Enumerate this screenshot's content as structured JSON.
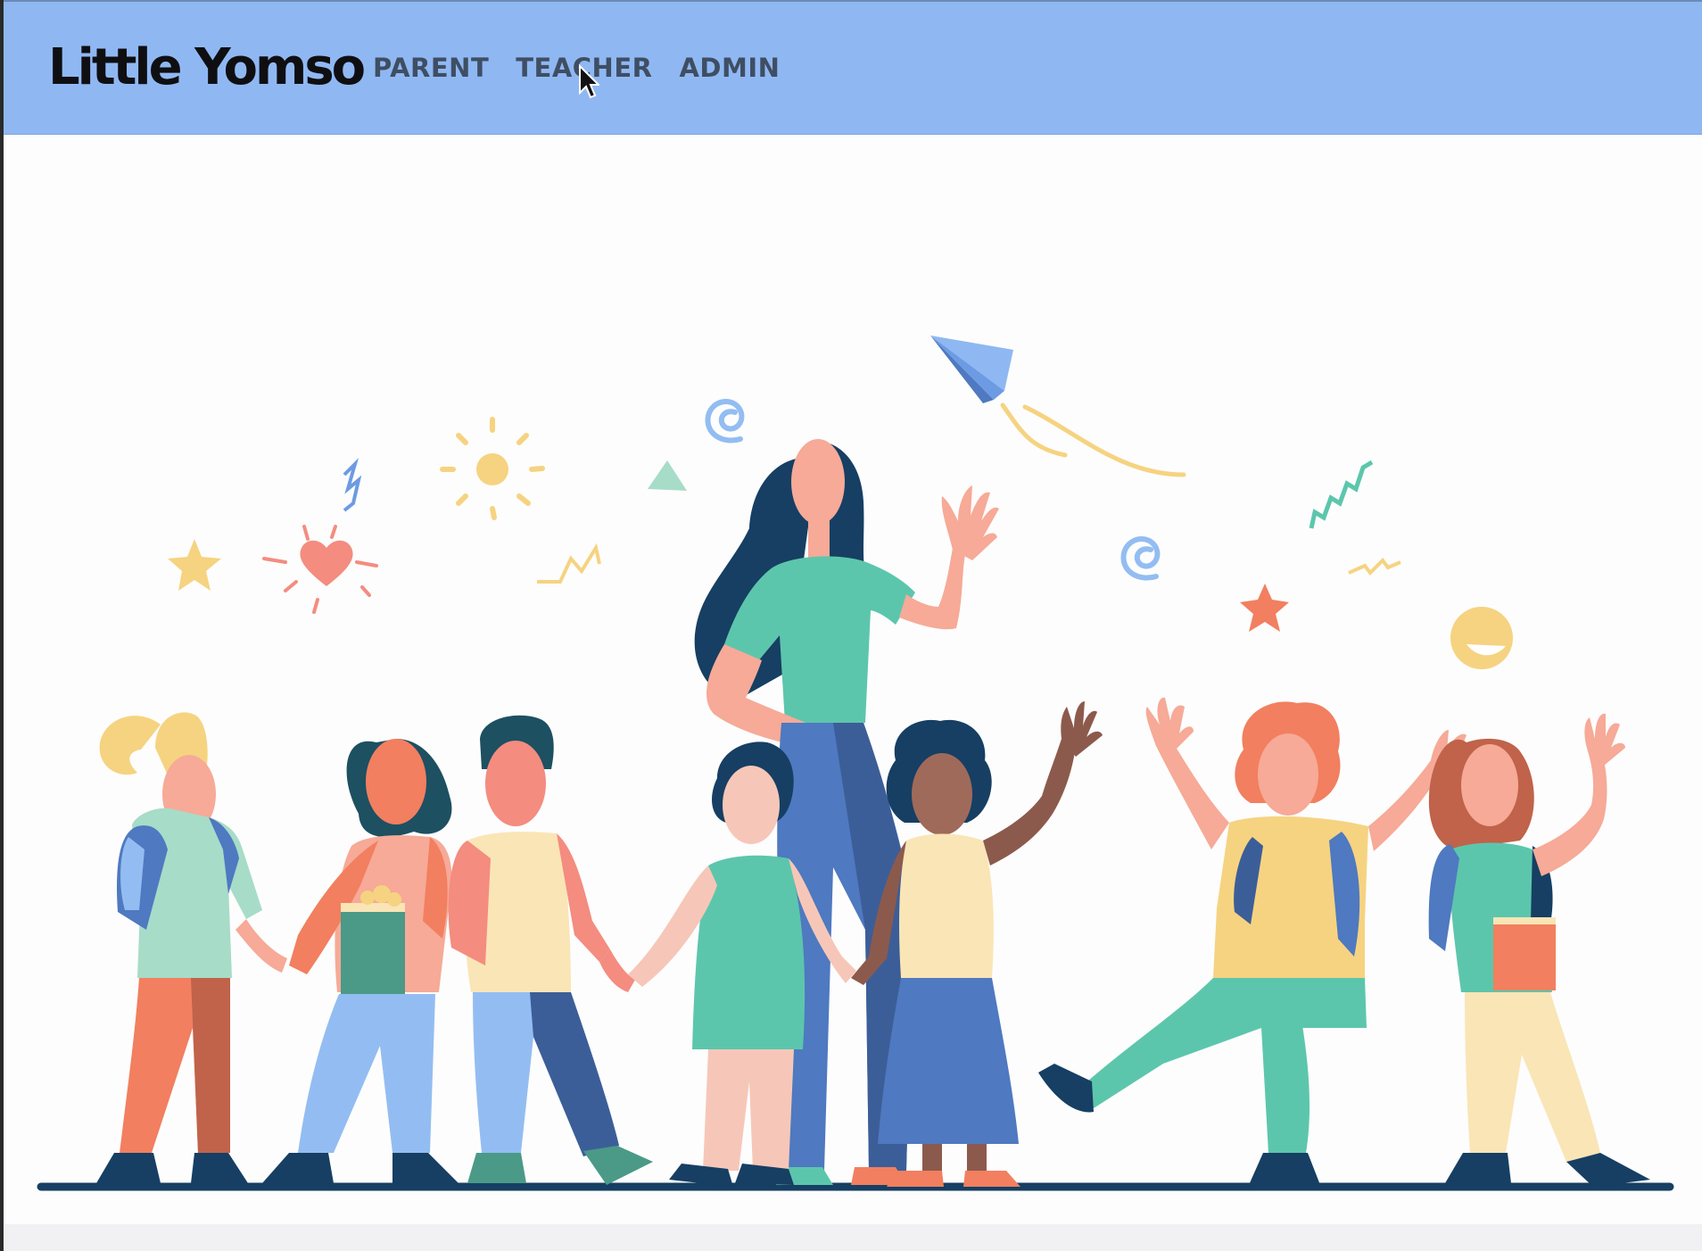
{
  "app": {
    "brand": "Little Yomso"
  },
  "nav": {
    "items": [
      {
        "label": "PARENT"
      },
      {
        "label": "TEACHER"
      },
      {
        "label": "ADMIN"
      }
    ]
  },
  "colors": {
    "navbar": "#8fb8f3",
    "brand_text": "#0f0f12",
    "nav_text": "#3f4e63",
    "teal": "#5cc6ac",
    "navy": "#163f63",
    "blue": "#4f79c0",
    "light_blue": "#93bdf2",
    "skin": "#f6aa97",
    "salmon": "#f27f5f",
    "yellow": "#f6d381",
    "cream": "#fae5b6"
  },
  "hero": {
    "illustration": "teacher-with-children-illustration"
  }
}
